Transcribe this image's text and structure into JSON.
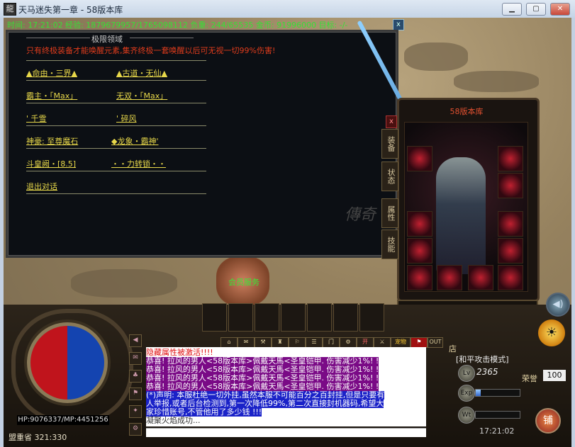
{
  "window": {
    "title": "天马迷失第一章 - 58版本库",
    "min_label": "▁",
    "max_label": "▢",
    "close_label": "✕"
  },
  "status_line": {
    "text": "时间: 17:21:02  经验: 1879679957/1765098112  负重: 244/65535  金币: 91996000  目标: -/-",
    "close_label": "x"
  },
  "dialog": {
    "title": "极限领域",
    "warning": "只有终极装备才能唤醒元素,集齐终极一套唤醒以后可无视一切99%伤害!",
    "options": [
      [
        "▲命由・三界▲",
        "▲古道・无仙▲"
      ],
      [
        "霸主・「Max」",
        "无双・「Max」"
      ],
      [
        "' 千雪",
        "' 碎风"
      ],
      [
        "神豪: 至尊魔石",
        "◆龙象・霸神'"
      ],
      [
        "斗皇阙・[8.5]",
        "・・力转锁・・"
      ]
    ],
    "exit_label": "退出对话",
    "watermark": "傳奇"
  },
  "character_panel": {
    "title": "58版本库",
    "close_label": "x",
    "tabs": [
      "装备",
      "状态",
      "属性",
      "技能"
    ]
  },
  "npc": {
    "name": "会员服务"
  },
  "player": {
    "hpmp_text": "HP:9076337/MP:4451256",
    "location": "盟重省  321:330",
    "level": "2365",
    "exp_fraction": 0.12,
    "attack_mode": "[和平攻击模式]",
    "honor_label": "荣誉",
    "honor_value": "100",
    "clock": "17:21:02",
    "shop_tag": "店",
    "shop_button": "铺",
    "level_icon": "Lv",
    "exp_icon": "Exp",
    "weight_icon": "Wt"
  },
  "chat_toolbar": [
    "⌂",
    "✉",
    "⚒",
    "♜",
    "⚐",
    "☰",
    "门",
    "⚙",
    "开",
    "⚔",
    "宠物",
    "⚑",
    "OUT"
  ],
  "chat": {
    "lines": [
      {
        "text": "隐藏属性被激活!!!!",
        "style": "red-on-white"
      },
      {
        "text": "恭喜! 拉风的男人<58版本库>佩戴天馬<圣皇铠甲. 伤害减少1%! !",
        "style": "purple"
      },
      {
        "text": "恭喜! 拉风的男人<58版本库>佩戴天馬<圣皇铠甲. 伤害减少1%! !",
        "style": "purple"
      },
      {
        "text": "恭喜! 拉风的男人<58版本库>佩戴天馬<圣皇铠甲. 伤害减少1%! !",
        "style": "purple"
      },
      {
        "text": "恭喜! 拉风的男人<58版本库>佩戴天馬<圣皇铠甲. 伤害减少1%! !",
        "style": "purple"
      },
      {
        "text": "(*)声明: 本服杜绝一切外挂,虽然本服不可能百分之百封挂,但是只要有",
        "style": "blue"
      },
      {
        "text": "人举报,或者后台检测到,第一次降低99%,第二次直接封机器码,希望大",
        "style": "blue"
      },
      {
        "text": "家珍惜账号,不管他用了多少钱 !!!",
        "style": "blue"
      },
      {
        "text": "凝聚火焰成功...",
        "style": "plain"
      }
    ]
  },
  "colors": {
    "status_green": "#36e036",
    "warning_red": "#e03c1c",
    "option_yellow": "#e8d84a",
    "chat_purple": "#7a0a86",
    "chat_blue": "#1a22c8"
  }
}
